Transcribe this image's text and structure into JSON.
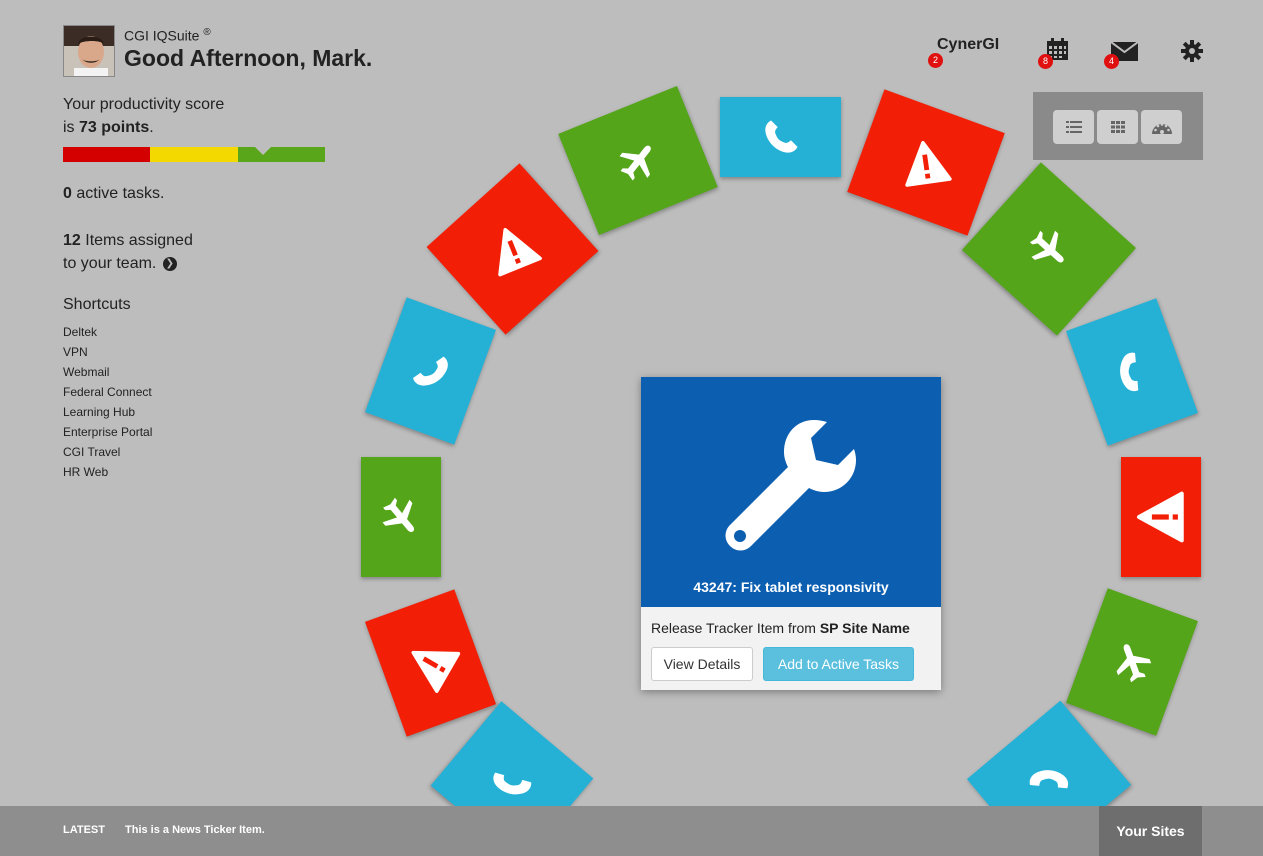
{
  "header": {
    "brand": "CGI IQSuite",
    "brand_mark": "®",
    "greeting": "Good Afternoon, Mark."
  },
  "sidebar": {
    "score_line1": "Your productivity score",
    "score_prefix": "is ",
    "score_value": "73 points",
    "score_suffix": ".",
    "score_percent": 73,
    "score_colors": [
      "#d40000",
      "#f4d900",
      "#5aa61b"
    ],
    "active_count": "0",
    "active_text": " active tasks.",
    "assigned_count": "12",
    "assigned_text1": " Items assigned",
    "assigned_text2": "to your team. ",
    "shortcuts_title": "Shortcuts",
    "shortcuts": [
      "Deltek",
      "VPN",
      "Webmail",
      "Federal Connect",
      "Learning Hub",
      "Enterprise Portal",
      "CGI Travel",
      "HR Web"
    ]
  },
  "topnav": {
    "cynergi_label": "CynerGI",
    "cynergi_badge": "2",
    "calendar_badge": "8",
    "mail_badge": "4",
    "badge_color": "#e01010"
  },
  "tile_colors": {
    "phone": "#25b1d6",
    "travel": "#55a51a",
    "alert": "#f21e05"
  },
  "card": {
    "title": "43247: Fix tablet responsivity",
    "sub_prefix": "Release Tracker Item from ",
    "sub_bold": "SP Site Name",
    "view_details": "View Details",
    "add_active": "Add to Active Tasks"
  },
  "ticker": {
    "label": "LATEST",
    "text": "This is a News Ticker Item.",
    "your_sites": "Your Sites"
  }
}
